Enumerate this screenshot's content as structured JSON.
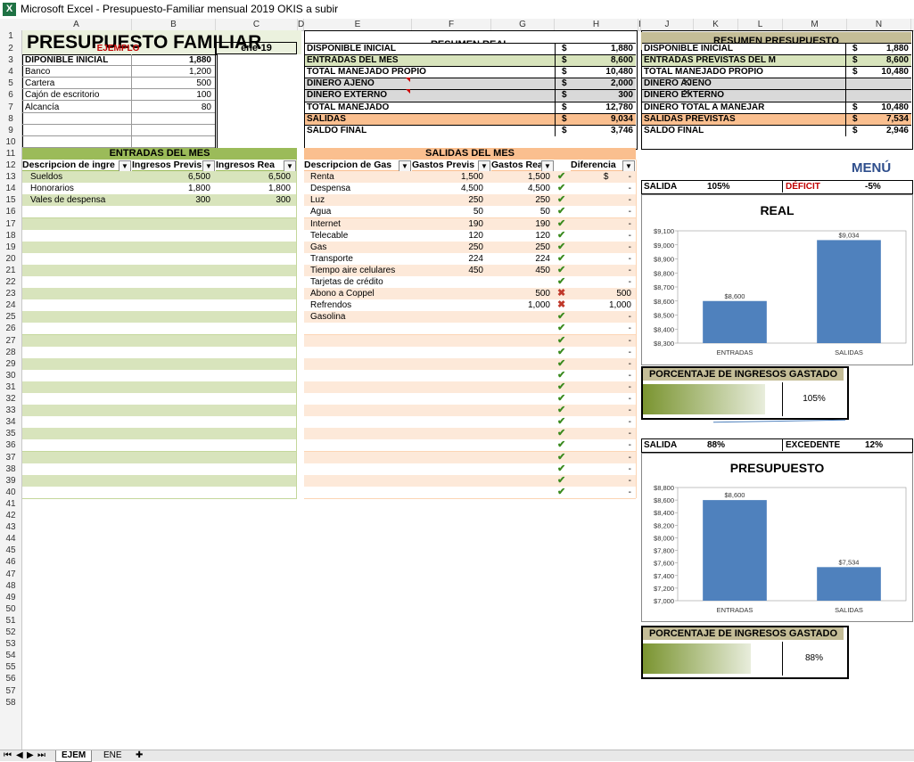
{
  "window": {
    "title": "Microsoft Excel - Presupuesto-Familiar mensual 2019 OKIS a subir"
  },
  "columns": [
    "A",
    "B",
    "C",
    "D",
    "E",
    "F",
    "G",
    "H",
    "I",
    "J",
    "K",
    "L",
    "M",
    "N"
  ],
  "rows": [
    "1",
    "2",
    "3",
    "4",
    "5",
    "6",
    "7",
    "8",
    "9",
    "10",
    "11",
    "12",
    "13",
    "14",
    "15",
    "16",
    "17",
    "18",
    "19",
    "20",
    "21",
    "22",
    "23",
    "24",
    "25",
    "26",
    "27",
    "28",
    "29",
    "30",
    "31",
    "32",
    "33",
    "34",
    "35",
    "36",
    "37",
    "38",
    "39",
    "40",
    "41",
    "42",
    "43",
    "44",
    "45",
    "46",
    "47",
    "48",
    "49",
    "50",
    "51",
    "52",
    "53",
    "54",
    "55",
    "56",
    "57",
    "58"
  ],
  "header": {
    "title": "PRESUPUESTO FAMILIAR",
    "ejemplo": "EJEMPLO",
    "mes": "ene-19"
  },
  "inicial": {
    "label": "DIPONIBLE INICIAL",
    "value": "1,880",
    "items": [
      {
        "label": "Banco",
        "value": "1,200"
      },
      {
        "label": "Cartera",
        "value": "500"
      },
      {
        "label": "Cajón de escritorio",
        "value": "100"
      },
      {
        "label": "Alcancía",
        "value": "80"
      }
    ]
  },
  "resumen_real": {
    "title": "RESUMEN REAL",
    "rows": [
      {
        "label": "DISPONIBLE INICIAL",
        "cur": "$",
        "value": "1,880"
      },
      {
        "label": "ENTRADAS DEL MES",
        "cur": "$",
        "value": "8,600"
      },
      {
        "label": "TOTAL MANEJADO PROPIO",
        "cur": "$",
        "value": "10,480"
      },
      {
        "label": "DINERO AJENO",
        "cur": "$",
        "value": "2,000"
      },
      {
        "label": "DINERO EXTERNO",
        "cur": "$",
        "value": "300"
      },
      {
        "label": "TOTAL MANEJADO",
        "cur": "$",
        "value": "12,780"
      },
      {
        "label": "SALIDAS",
        "cur": "$",
        "value": "9,034"
      },
      {
        "label": "SALDO FINAL",
        "cur": "$",
        "value": "3,746"
      }
    ]
  },
  "resumen_presupuesto": {
    "title": "RESUMEN PRESUPUESTO",
    "rows": [
      {
        "label": "DISPONIBLE INICIAL",
        "cur": "$",
        "value": "1,880"
      },
      {
        "label": "ENTRADAS PREVISTAS DEL M",
        "cur": "$",
        "value": "8,600"
      },
      {
        "label": "TOTAL MANEJADO PROPIO",
        "cur": "$",
        "value": "10,480"
      },
      {
        "label": "DINERO AJENO",
        "cur": "",
        "value": ""
      },
      {
        "label": "DINERO EXTERNO",
        "cur": "",
        "value": ""
      },
      {
        "label": "DINERO TOTAL A MANEJAR",
        "cur": "$",
        "value": "10,480"
      },
      {
        "label": "SALIDAS PREVISTAS",
        "cur": "$",
        "value": "7,534"
      },
      {
        "label": "SALDO FINAL",
        "cur": "$",
        "value": "2,946"
      }
    ]
  },
  "entradas": {
    "title": "ENTRADAS DEL MES",
    "headers": [
      "Descripcion de ingre",
      "Ingresos Previs",
      "Ingresos Rea"
    ],
    "items": [
      {
        "desc": "Sueldos",
        "prev": "6,500",
        "real": "6,500"
      },
      {
        "desc": "Honorarios",
        "prev": "1,800",
        "real": "1,800"
      },
      {
        "desc": "Vales de despensa",
        "prev": "300",
        "real": "300"
      }
    ]
  },
  "salidas": {
    "title": "SALIDAS DEL MES",
    "headers": [
      "Descripcion de Gas",
      "Gastos Previs",
      "Gastos Rea",
      "Diferencia"
    ],
    "items": [
      {
        "desc": "Renta",
        "prev": "1,500",
        "real": "1,500",
        "ok": true,
        "diff": "$        -"
      },
      {
        "desc": "Despensa",
        "prev": "4,500",
        "real": "4,500",
        "ok": true,
        "diff": "-"
      },
      {
        "desc": "Luz",
        "prev": "250",
        "real": "250",
        "ok": true,
        "diff": "-"
      },
      {
        "desc": "Agua",
        "prev": "50",
        "real": "50",
        "ok": true,
        "diff": "-"
      },
      {
        "desc": "Internet",
        "prev": "190",
        "real": "190",
        "ok": true,
        "diff": "-"
      },
      {
        "desc": "Telecable",
        "prev": "120",
        "real": "120",
        "ok": true,
        "diff": "-"
      },
      {
        "desc": "Gas",
        "prev": "250",
        "real": "250",
        "ok": true,
        "diff": "-"
      },
      {
        "desc": "Transporte",
        "prev": "224",
        "real": "224",
        "ok": true,
        "diff": "-"
      },
      {
        "desc": "Tiempo aire celulares",
        "prev": "450",
        "real": "450",
        "ok": true,
        "diff": "-"
      },
      {
        "desc": "Tarjetas de crédito",
        "prev": "",
        "real": "",
        "ok": true,
        "diff": "-"
      },
      {
        "desc": "Abono a Coppel",
        "prev": "",
        "real": "500",
        "ok": false,
        "diff": "500"
      },
      {
        "desc": "Refrendos",
        "prev": "",
        "real": "1,000",
        "ok": false,
        "diff": "1,000"
      },
      {
        "desc": "Gasolina",
        "prev": "",
        "real": "",
        "ok": true,
        "diff": "-"
      }
    ]
  },
  "menu_label": "MENÚ",
  "real_status": {
    "salida_label": "SALIDA",
    "salida_value": "105%",
    "status_label": "DÉFICIT",
    "status_value": "-5%"
  },
  "presu_status": {
    "salida_label": "SALIDA",
    "salida_value": "88%",
    "status_label": "EXCEDENTE",
    "status_value": "12%"
  },
  "porcentaje_real": {
    "label": "PORCENTAJE DE INGRESOS GASTADO",
    "value": "105%",
    "fill": 1.0
  },
  "porcentaje_presu": {
    "label": "PORCENTAJE DE INGRESOS GASTADO",
    "value": "88%",
    "fill": 0.88
  },
  "chart_data": [
    {
      "type": "bar",
      "title": "REAL",
      "categories": [
        "ENTRADAS",
        "SALIDAS"
      ],
      "values": [
        8600,
        9034
      ],
      "value_labels": [
        "$8,600",
        "$9,034"
      ],
      "ylim": [
        8300,
        9100
      ],
      "yticks": [
        8300,
        8400,
        8500,
        8600,
        8700,
        8800,
        8900,
        9000,
        9100
      ],
      "ytick_labels": [
        "$8,300",
        "$8,400",
        "$8,500",
        "$8,600",
        "$8,700",
        "$8,800",
        "$8,900",
        "$9,000",
        "$9,100"
      ],
      "color": "#4f81bd"
    },
    {
      "type": "bar",
      "title": "PRESUPUESTO",
      "categories": [
        "ENTRADAS",
        "SALIDAS"
      ],
      "values": [
        8600,
        7534
      ],
      "value_labels": [
        "$8,600",
        "$7,534"
      ],
      "ylim": [
        7000,
        8800
      ],
      "yticks": [
        7000,
        7200,
        7400,
        7600,
        7800,
        8000,
        8200,
        8400,
        8600,
        8800
      ],
      "ytick_labels": [
        "$7,000",
        "$7,200",
        "$7,400",
        "$7,600",
        "$7,800",
        "$8,000",
        "$8,200",
        "$8,400",
        "$8,600",
        "$8,800"
      ],
      "color": "#4f81bd"
    }
  ],
  "sheet_tabs": [
    {
      "label": "EJEM",
      "active": true
    },
    {
      "label": "ENE",
      "active": false
    }
  ]
}
